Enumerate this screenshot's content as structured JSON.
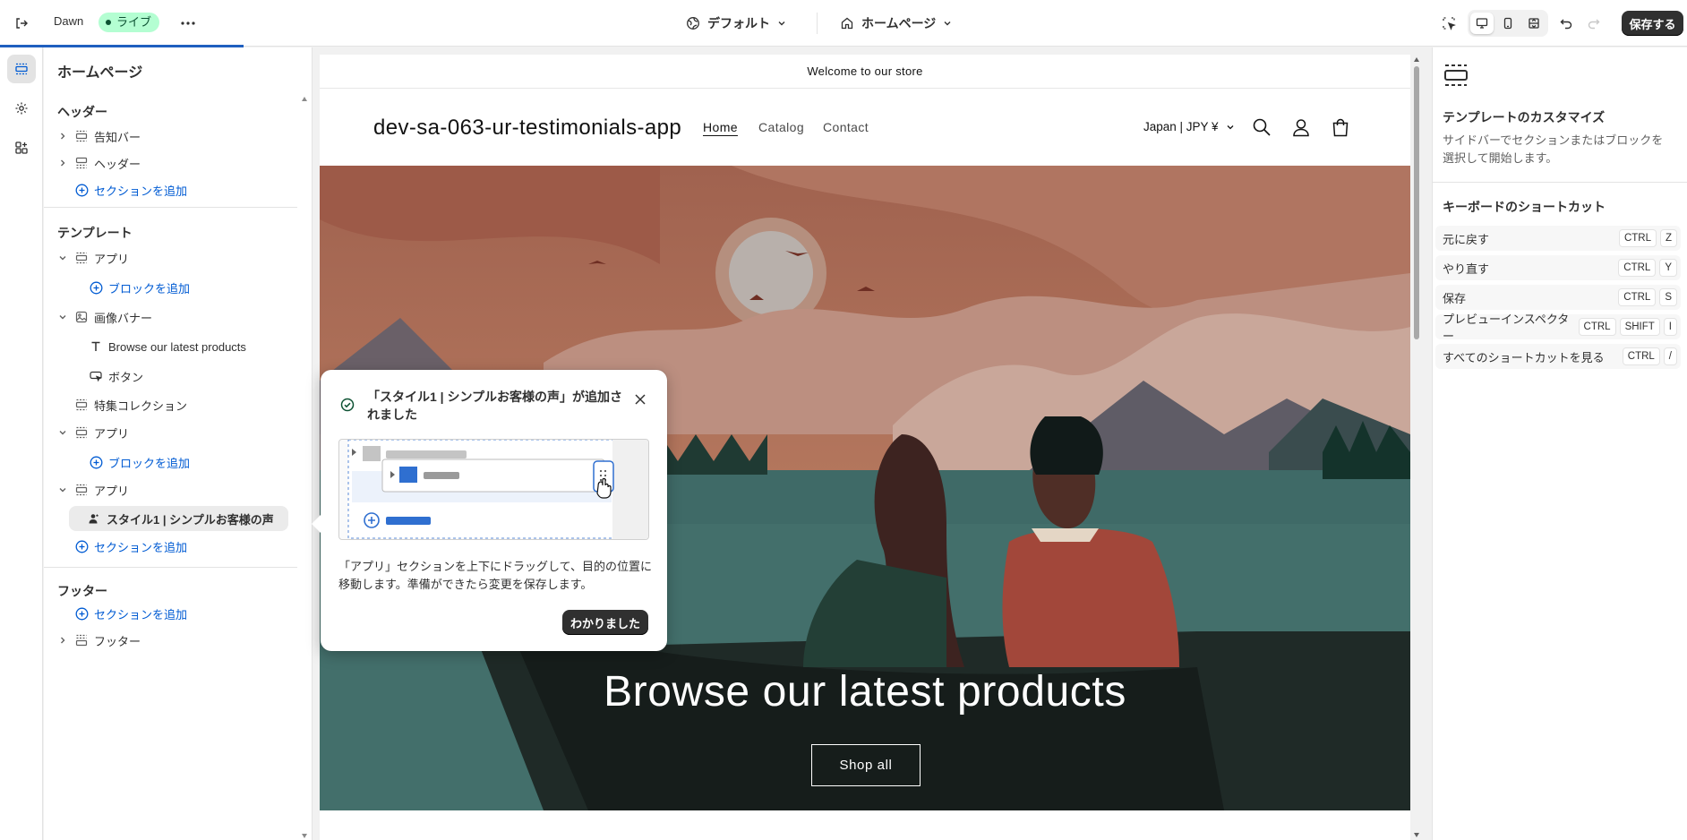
{
  "topbar": {
    "theme_name": "Dawn",
    "live_badge": "ライブ",
    "theme_setting": "デフォルト",
    "page_selector": "ホームページ",
    "save_label": "保存する"
  },
  "sidebar": {
    "title": "ホームページ",
    "header_section": {
      "label": "ヘッダー",
      "items": [
        "告知バー",
        "ヘッダー"
      ],
      "add_section": "セクションを追加"
    },
    "template_section": {
      "label": "テンプレート",
      "app_1": "アプリ",
      "add_block_1": "ブロックを追加",
      "image_banner": "画像バナー",
      "banner_text": "Browse our latest products",
      "banner_button": "ボタン",
      "featured_collection": "特集コレクション",
      "app_2": "アプリ",
      "add_block_2": "ブロックを追加",
      "app_3": "アプリ",
      "testimonial_block": "スタイル1 | シンプルお客様の声",
      "add_section": "セクションを追加"
    },
    "footer_section": {
      "label": "フッター",
      "add_section": "セクションを追加",
      "footer_item": "フッター"
    }
  },
  "preview": {
    "announcement": "Welcome to our store",
    "store_name": "dev-sa-063-ur-testimonials-app",
    "nav": [
      "Home",
      "Catalog",
      "Contact"
    ],
    "locale": "Japan | JPY ¥",
    "hero_heading": "Browse our latest products",
    "hero_button": "Shop all"
  },
  "right_panel": {
    "title": "テンプレートのカスタマイズ",
    "description": "サイドバーでセクションまたはブロックを選択して開始します。",
    "shortcuts_title": "キーボードのショートカット",
    "shortcuts": [
      {
        "label": "元に戻す",
        "keys": [
          "CTRL",
          "Z"
        ]
      },
      {
        "label": "やり直す",
        "keys": [
          "CTRL",
          "Y"
        ]
      },
      {
        "label": "保存",
        "keys": [
          "CTRL",
          "S"
        ]
      },
      {
        "label": "プレビューインスペクター",
        "keys": [
          "CTRL",
          "SHIFT",
          "I"
        ]
      },
      {
        "label": "すべてのショートカットを見る",
        "keys": [
          "CTRL",
          "/"
        ]
      }
    ]
  },
  "popover": {
    "title": "「スタイル1 | シンプルお客様の声」が追加されました",
    "body": "「アプリ」セクションを上下にドラッグして、目的の位置に移動します。準備ができたら変更を保存します。",
    "button": "わかりました"
  },
  "colors": {
    "accent_blue": "#005bd3",
    "live_badge_bg": "#b4fed2",
    "primary_button": "#303030"
  }
}
